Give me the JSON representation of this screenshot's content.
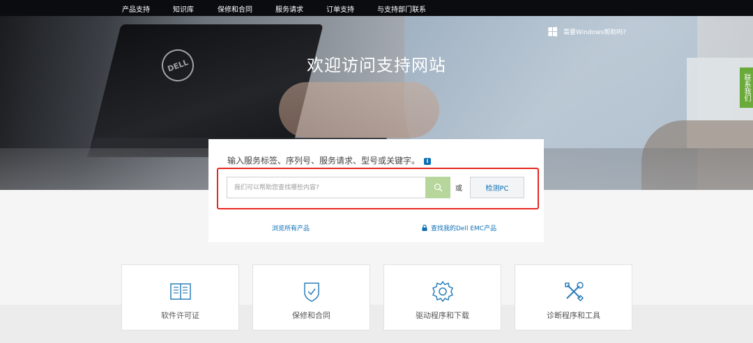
{
  "nav": {
    "items": [
      {
        "label": "产品支持"
      },
      {
        "label": "知识库"
      },
      {
        "label": "保修和合同"
      },
      {
        "label": "服务请求"
      },
      {
        "label": "订单支持"
      },
      {
        "label": "与支持部门联系"
      }
    ]
  },
  "hero": {
    "title": "欢迎访问支持网站",
    "windows_help": "需要Windows帮助吗?",
    "logo_text": "DELL"
  },
  "contact_tab": {
    "label": "联系我们"
  },
  "search": {
    "prompt": "输入服务标签、序列号、服务请求、型号或关键字。",
    "info_icon_text": "i",
    "placeholder": "我们可以帮助您查找哪些内容?",
    "or_text": "或",
    "detect_label": "检测PC",
    "browse_label": "浏览所有产品",
    "find_label": "查找我的Dell EMC产品"
  },
  "tiles": [
    {
      "label": "软件许可证",
      "icon": "book-icon"
    },
    {
      "label": "保修和合同",
      "icon": "shield-check-icon"
    },
    {
      "label": "驱动程序和下载",
      "icon": "gear-icon"
    },
    {
      "label": "诊断程序和工具",
      "icon": "tools-icon"
    }
  ],
  "colors": {
    "accent": "#0b6fb5",
    "highlight": "#e5261f",
    "search_button": "#b6d69b",
    "contact_tab": "#6aaa3a"
  }
}
